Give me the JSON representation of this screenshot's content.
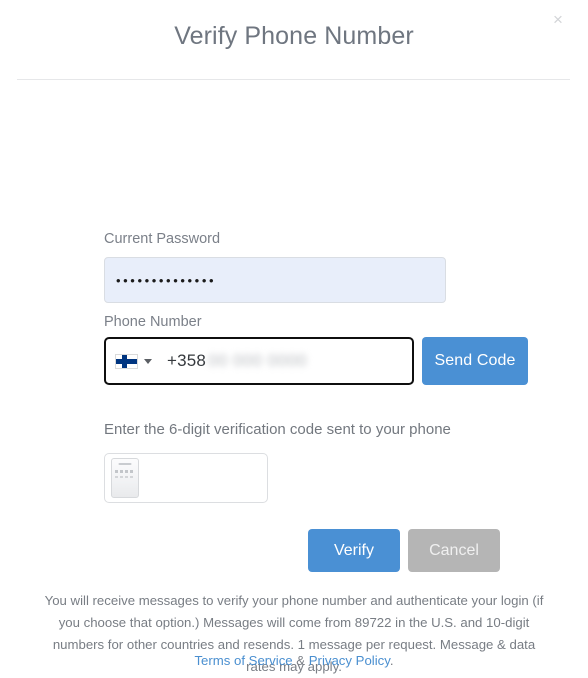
{
  "modal": {
    "title": "Verify Phone Number",
    "close_label": "×"
  },
  "form": {
    "password": {
      "label": "Current Password",
      "value": "••••••••••••••",
      "placeholder": ""
    },
    "phone": {
      "label": "Phone Number",
      "country_flag": "finland-flag",
      "country_code": "+358",
      "number_redacted": "00 000 0000",
      "send_code_label": "Send Code"
    },
    "code": {
      "label": "Enter the 6-digit verification code sent to your phone",
      "value": "",
      "placeholder": "",
      "autofill_icon": "sms-autofill-phone-icon"
    }
  },
  "actions": {
    "verify_label": "Verify",
    "cancel_label": "Cancel"
  },
  "footer": {
    "note": "You will receive messages to verify your phone number and authenticate your login (if you choose that option.) Messages will come from 89722 in the U.S. and 10-digit numbers for other countries and resends. 1 message per request. Message & data rates may apply.",
    "terms_label": "Terms of Service",
    "separator": " & ",
    "privacy_label": "Privacy Policy",
    "period": "."
  },
  "colors": {
    "accent_blue": "#4a90d4",
    "cancel_gray": "#b5b5b5",
    "autofill_bg": "#e8eefa",
    "link_blue": "#4a8fd0",
    "flag_blue": "#003580"
  }
}
